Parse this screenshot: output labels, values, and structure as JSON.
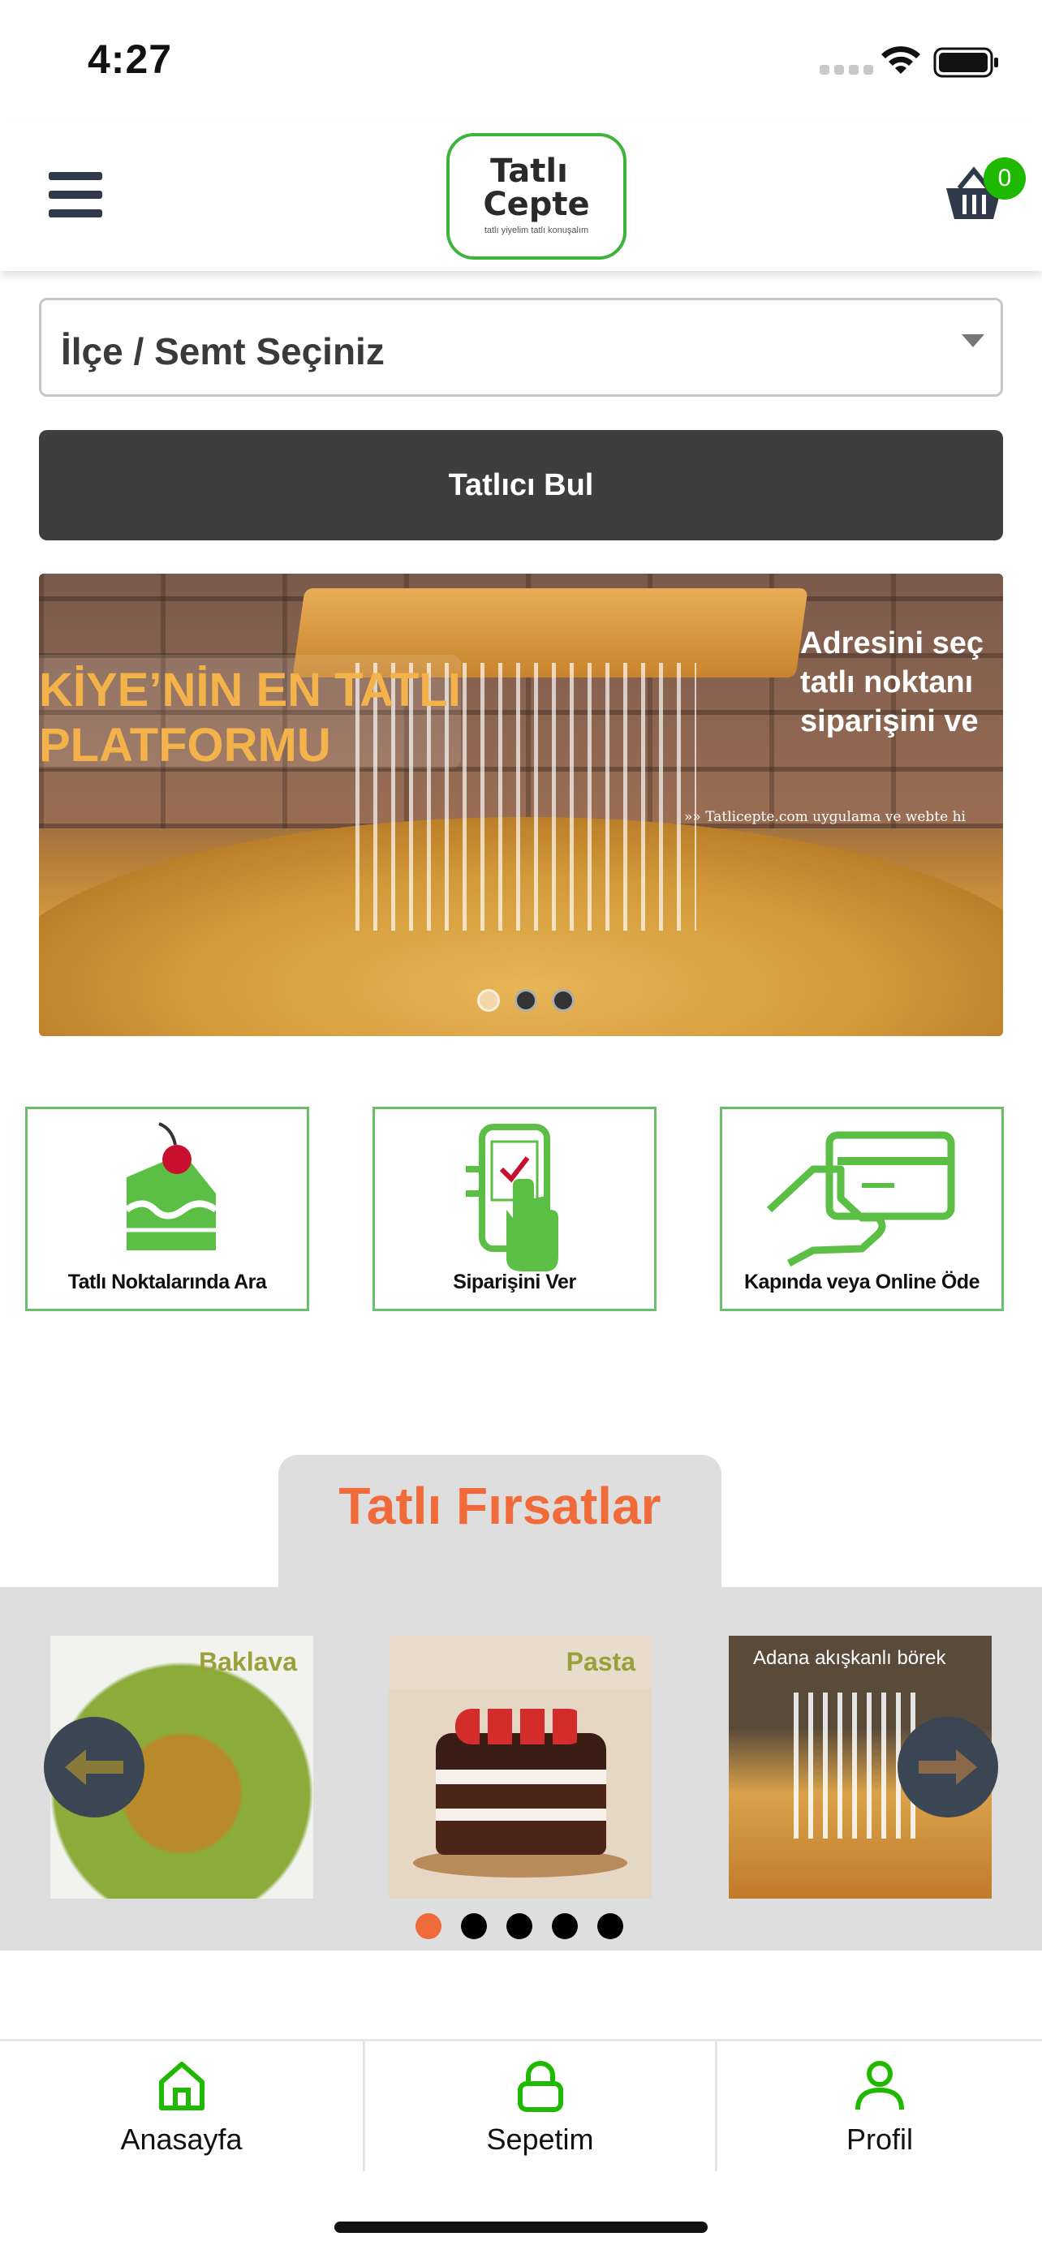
{
  "status_bar": {
    "time": "4:27"
  },
  "header": {
    "logo_line1": "Tatlı",
    "logo_line2": "Cepte",
    "logo_tagline": "tatlı yiyelim tatlı konuşalım",
    "cart_count": "0"
  },
  "search": {
    "district_placeholder": "İlçe / Semt Seçiniz",
    "find_button_label": "Tatlıcı Bul"
  },
  "banner": {
    "headline": "KİYE’NİN EN TATLI\nPLATFORMU",
    "right_text": "Adresini seç\ntatlı noktanı\nsiparişini ve",
    "site_text": "Tatlicepte.com uygulama ve webte hi",
    "slide_count": 3,
    "active_slide": 0
  },
  "features": [
    {
      "label": "Tatlı Noktalarında Ara",
      "icon": "cake-slice-icon"
    },
    {
      "label": "Siparişini Ver",
      "icon": "phone-tap-icon"
    },
    {
      "label": "Kapında veya Online Öde",
      "icon": "card-payment-icon"
    }
  ],
  "deals": {
    "title": "Tatlı Fırsatlar",
    "items": [
      {
        "label": "Baklava"
      },
      {
        "label": "Pasta"
      },
      {
        "label": "Adana akışkanlı börek"
      }
    ],
    "page_count": 5,
    "active_page": 0
  },
  "bottom_nav": [
    {
      "label": "Anasayfa",
      "icon": "home-icon"
    },
    {
      "label": "Sepetim",
      "icon": "lock-icon"
    },
    {
      "label": "Profil",
      "icon": "user-icon"
    }
  ],
  "colors": {
    "brand_green": "#1eb900",
    "accent_orange": "#f06a3a",
    "button_dark": "#3e3e3e",
    "nav_arrow": "#3b4654"
  }
}
